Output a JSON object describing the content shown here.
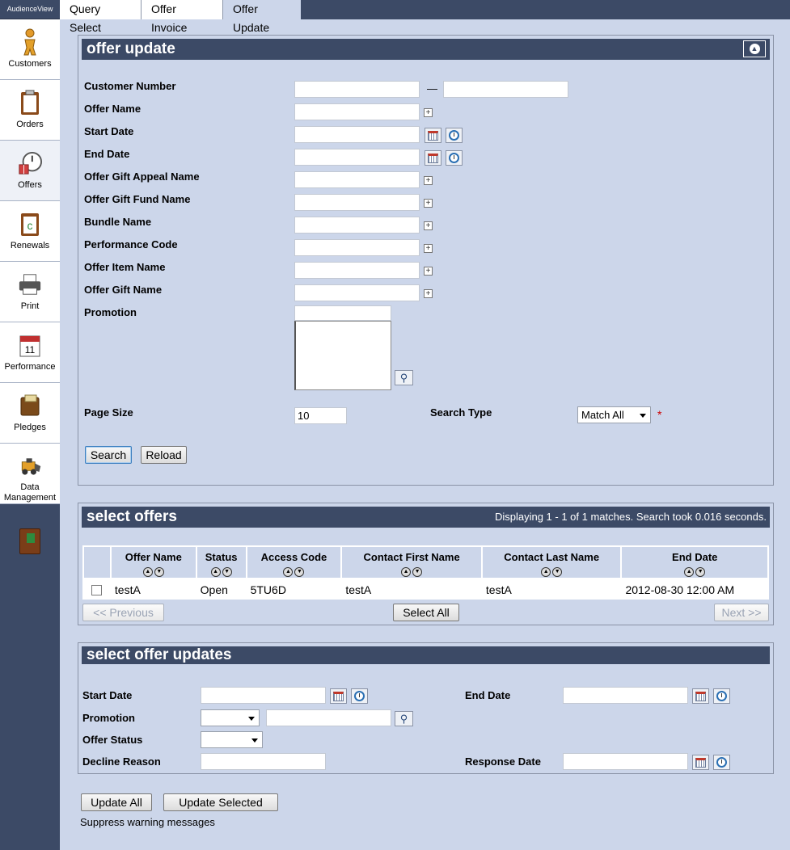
{
  "app": {
    "brand": "AudienceView"
  },
  "sidebar": {
    "items": [
      {
        "label": "Customers"
      },
      {
        "label": "Orders"
      },
      {
        "label": "Offers"
      },
      {
        "label": "Renewals"
      },
      {
        "label": "Print"
      },
      {
        "label": "Performance"
      },
      {
        "label": "Pledges"
      },
      {
        "label": "Data Management"
      }
    ]
  },
  "tabs": [
    {
      "label": "Query Select"
    },
    {
      "label": "Offer Invoice"
    },
    {
      "label": "Offer Update"
    }
  ],
  "offer_update": {
    "title": "offer update",
    "fields": {
      "customer_number": "Customer Number",
      "customer_number_sep": "—",
      "offer_name": "Offer Name",
      "start_date": "Start Date",
      "end_date": "End Date",
      "offer_gift_appeal_name": "Offer Gift Appeal Name",
      "offer_gift_fund_name": "Offer Gift Fund Name",
      "bundle_name": "Bundle Name",
      "performance_code": "Performance Code",
      "offer_item_name": "Offer Item Name",
      "offer_gift_name": "Offer Gift Name",
      "promotion": "Promotion",
      "page_size": "Page Size",
      "page_size_value": "10",
      "search_type": "Search Type",
      "search_type_value": "Match All",
      "required_mark": "*"
    },
    "buttons": {
      "search": "Search",
      "reload": "Reload"
    }
  },
  "select_offers": {
    "title": "select offers",
    "status_text": "Displaying 1 - 1 of 1 matches. Search took 0.016 seconds.",
    "columns": [
      "Offer Name",
      "Status",
      "Access Code",
      "Contact First Name",
      "Contact Last Name",
      "End Date"
    ],
    "rows": [
      {
        "offer_name": "testA",
        "status": "Open",
        "access_code": "5TU6D",
        "contact_first_name": "testA",
        "contact_last_name": "testA",
        "end_date": "2012-08-30 12:00 AM"
      }
    ],
    "buttons": {
      "previous": "<< Previous",
      "select_all": "Select All",
      "next": "Next >>"
    }
  },
  "select_offer_updates": {
    "title": "select offer updates",
    "fields": {
      "start_date": "Start Date",
      "end_date": "End Date",
      "promotion": "Promotion",
      "offer_status": "Offer Status",
      "decline_reason": "Decline Reason",
      "response_date": "Response Date"
    }
  },
  "footer": {
    "update_all": "Update All",
    "update_selected": "Update Selected",
    "suppress_warnings": "Suppress warning messages"
  },
  "colors": {
    "header_bg": "#3c4a66",
    "panel_bg": "#ccd6ea",
    "accent_required": "#cc0000"
  }
}
